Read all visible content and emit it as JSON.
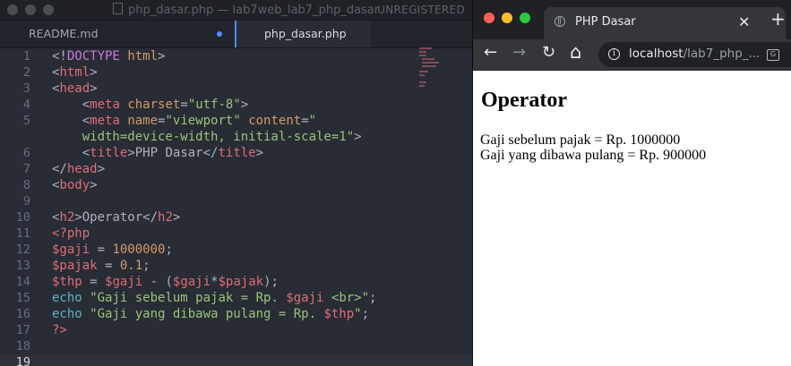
{
  "editor": {
    "title": "php_dasar.php — lab7web_lab7_php_dasar",
    "license": "UNREGISTERED",
    "tabs": [
      {
        "label": "README.md",
        "modified": true
      },
      {
        "label": "php_dasar.php",
        "active": true
      }
    ],
    "active_line": 19,
    "lines": [
      {
        "n": "1",
        "tokens": [
          [
            "t-txt",
            "<!"
          ],
          [
            "t-doct",
            "DOCTYPE"
          ],
          [
            "t-txt",
            " "
          ],
          [
            "t-attr",
            "html"
          ],
          [
            "t-txt",
            ">"
          ]
        ]
      },
      {
        "n": "2",
        "tokens": [
          [
            "t-txt",
            "<"
          ],
          [
            "t-tag",
            "html"
          ],
          [
            "t-txt",
            ">"
          ]
        ]
      },
      {
        "n": "3",
        "tokens": [
          [
            "t-txt",
            "<"
          ],
          [
            "t-tag",
            "head"
          ],
          [
            "t-txt",
            ">"
          ]
        ]
      },
      {
        "n": "4",
        "tokens": [
          [
            "t-txt",
            "    <"
          ],
          [
            "t-tag",
            "meta"
          ],
          [
            "t-txt",
            " "
          ],
          [
            "t-attr",
            "charset"
          ],
          [
            "t-txt",
            "="
          ],
          [
            "t-str",
            "\"utf-8\""
          ],
          [
            "t-txt",
            ">"
          ]
        ]
      },
      {
        "n": "5",
        "tokens": [
          [
            "t-txt",
            "    <"
          ],
          [
            "t-tag",
            "meta"
          ],
          [
            "t-txt",
            " "
          ],
          [
            "t-attr",
            "name"
          ],
          [
            "t-txt",
            "="
          ],
          [
            "t-str",
            "\"viewport\""
          ],
          [
            "t-txt",
            " "
          ],
          [
            "t-attr",
            "content"
          ],
          [
            "t-txt",
            "="
          ],
          [
            "t-str",
            "\""
          ]
        ]
      },
      {
        "n": "",
        "tokens": [
          [
            "t-str",
            "    width=device-width, initial-scale=1\""
          ],
          [
            "t-txt",
            ">"
          ]
        ]
      },
      {
        "n": "6",
        "tokens": [
          [
            "t-txt",
            "    <"
          ],
          [
            "t-tag",
            "title"
          ],
          [
            "t-txt",
            ">PHP Dasar</"
          ],
          [
            "t-tag",
            "title"
          ],
          [
            "t-txt",
            ">"
          ]
        ]
      },
      {
        "n": "7",
        "tokens": [
          [
            "t-txt",
            "</"
          ],
          [
            "t-tag",
            "head"
          ],
          [
            "t-txt",
            ">"
          ]
        ]
      },
      {
        "n": "8",
        "tokens": [
          [
            "t-txt",
            "<"
          ],
          [
            "t-tag",
            "body"
          ],
          [
            "t-txt",
            ">"
          ]
        ]
      },
      {
        "n": "9",
        "tokens": []
      },
      {
        "n": "10",
        "tokens": [
          [
            "t-txt",
            "<"
          ],
          [
            "t-tag",
            "h2"
          ],
          [
            "t-txt",
            ">Operator</"
          ],
          [
            "t-tag",
            "h2"
          ],
          [
            "t-txt",
            ">"
          ]
        ]
      },
      {
        "n": "11",
        "tokens": [
          [
            "t-tag",
            "<?php"
          ]
        ]
      },
      {
        "n": "12",
        "tokens": [
          [
            "t-var",
            "$gaji"
          ],
          [
            "t-txt",
            " = "
          ],
          [
            "t-num",
            "1000000"
          ],
          [
            "t-txt",
            ";"
          ]
        ]
      },
      {
        "n": "13",
        "tokens": [
          [
            "t-var",
            "$pajak"
          ],
          [
            "t-txt",
            " = "
          ],
          [
            "t-num",
            "0.1"
          ],
          [
            "t-txt",
            ";"
          ]
        ]
      },
      {
        "n": "14",
        "tokens": [
          [
            "t-var",
            "$thp"
          ],
          [
            "t-txt",
            " = "
          ],
          [
            "t-var",
            "$gaji"
          ],
          [
            "t-txt",
            " - ("
          ],
          [
            "t-var",
            "$gaji"
          ],
          [
            "t-txt",
            "*"
          ],
          [
            "t-var",
            "$pajak"
          ],
          [
            "t-txt",
            ");"
          ]
        ]
      },
      {
        "n": "15",
        "tokens": [
          [
            "t-kw",
            "echo"
          ],
          [
            "t-txt",
            " "
          ],
          [
            "t-str",
            "\"Gaji sebelum pajak = Rp. "
          ],
          [
            "t-var",
            "$gaji"
          ],
          [
            "t-str",
            " <br>\""
          ],
          [
            "t-txt",
            ";"
          ]
        ]
      },
      {
        "n": "16",
        "tokens": [
          [
            "t-kw",
            "echo"
          ],
          [
            "t-txt",
            " "
          ],
          [
            "t-str",
            "\"Gaji yang dibawa pulang = Rp. "
          ],
          [
            "t-var",
            "$thp"
          ],
          [
            "t-str",
            "\""
          ],
          [
            "t-txt",
            ";"
          ]
        ]
      },
      {
        "n": "17",
        "tokens": [
          [
            "t-tag",
            "?>"
          ]
        ]
      },
      {
        "n": "18",
        "tokens": []
      },
      {
        "n": "19",
        "tokens": []
      }
    ]
  },
  "browser": {
    "tab_title": "PHP Dasar",
    "close_glyph": "✕",
    "new_tab_glyph": "+",
    "url_host": "localhost",
    "url_path": "/lab7_php_...",
    "nav": {
      "back": "←",
      "forward": "→",
      "reload": "↻",
      "home": "⌂"
    },
    "info_glyph": "i",
    "page": {
      "heading": "Operator",
      "output": [
        "Gaji sebelum pajak = Rp. 1000000",
        "Gaji yang dibawa pulang = Rp. 900000"
      ]
    },
    "colors": {
      "close": "#ff5f57",
      "minimize": "#febc2e",
      "zoom": "#28c840"
    }
  }
}
